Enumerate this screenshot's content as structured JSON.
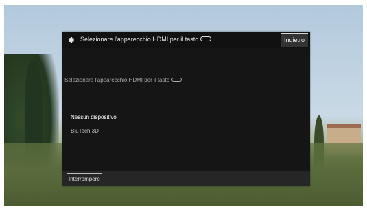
{
  "dialog": {
    "title": "Selezionare l'apparecchio HDMI per il tasto",
    "back_label": "Indietro",
    "subtitle": "Selezionare l'apparecchio HDMI per il tasto"
  },
  "devices": [
    {
      "label": "Nessun dispositivo",
      "selected": true
    },
    {
      "label": "BluTech 3D",
      "selected": false
    }
  ],
  "footer": {
    "stop_label": "Interrompere"
  },
  "icons": {
    "settings": "gear-icon",
    "hdmi_key": "hdmi-key-icon"
  },
  "colors": {
    "dialog_background": "#151515",
    "footer_background": "#262626",
    "button_background": "#333333"
  }
}
